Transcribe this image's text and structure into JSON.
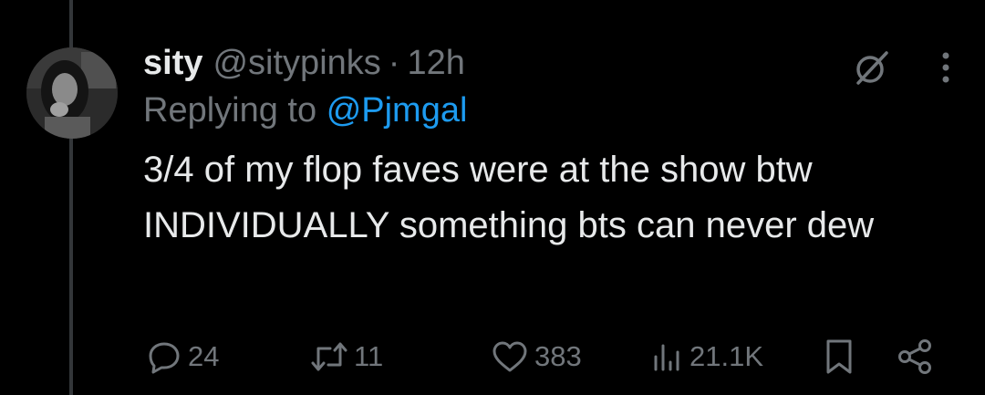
{
  "tweet": {
    "display_name": "sity",
    "handle": "@sitypinks",
    "separator": "·",
    "time": "12h",
    "replying_prefix": "Replying to",
    "replying_to": "@Pjmgal",
    "text": "3/4 of my flop faves were at the show btw INDIVIDUALLY something bts can never dew"
  },
  "actions": {
    "replies": "24",
    "reposts": "11",
    "likes": "383",
    "views": "21.1K"
  },
  "icons": {
    "top": [
      "grok-slash-icon",
      "more-vertical-icon"
    ],
    "actions": [
      "reply-icon",
      "repost-icon",
      "like-icon",
      "views-icon",
      "bookmark-icon",
      "share-icon"
    ]
  },
  "colors": {
    "background": "#000000",
    "primary_text": "#e7e9ea",
    "secondary_text": "#71767b",
    "link": "#1d9bf0",
    "thread_line": "#333639"
  }
}
